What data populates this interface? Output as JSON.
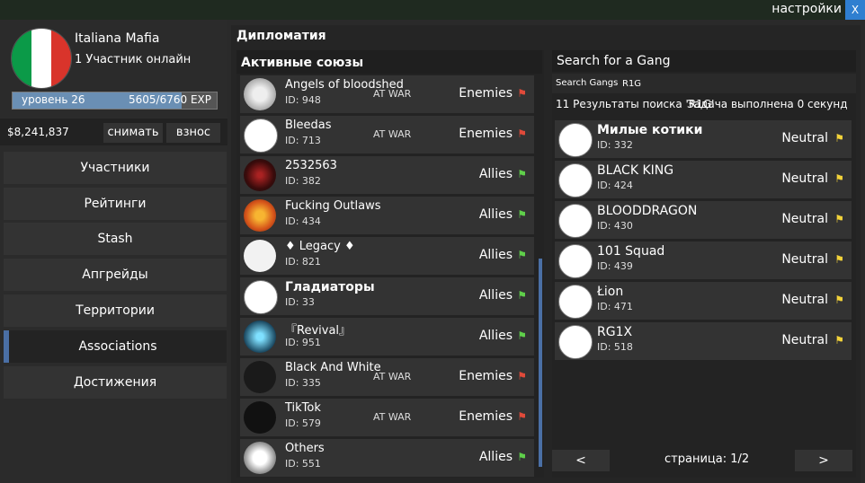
{
  "window": {
    "settings_label": "настройки",
    "close_label": "X"
  },
  "gang": {
    "name": "Italiana Mafia",
    "online": "1 Участник онлайн",
    "flag_colors": [
      "#0b9a48",
      "#ffffff",
      "#d9342b"
    ],
    "level": "уровень 26",
    "exp": "5605/6760 EXP",
    "exp_progress": 0.829,
    "money": "$8,241,837",
    "withdraw_label": "снимать",
    "deposit_label": "взнос"
  },
  "menu": [
    {
      "label": "Участники",
      "active": false
    },
    {
      "label": "Рейтинги",
      "active": false
    },
    {
      "label": "Stash",
      "active": false
    },
    {
      "label": "Апгрейды",
      "active": false
    },
    {
      "label": "Территории",
      "active": false
    },
    {
      "label": "Associations",
      "active": true
    },
    {
      "label": "Достижения",
      "active": false
    }
  ],
  "diplomacy": {
    "title": "Дипломатия",
    "alliances_title": "Активные союзы",
    "alliances": [
      {
        "name": "Angels of bloodshed",
        "id": "ID: 948",
        "war": "AT WAR",
        "relation": "Enemies",
        "avatar": "angels"
      },
      {
        "name": "Bleedas",
        "id": "ID: 713",
        "war": "AT WAR",
        "relation": "Enemies",
        "avatar": "blank"
      },
      {
        "name": "2532563",
        "id": "ID: 382",
        "war": "",
        "relation": "Allies",
        "avatar": "fire"
      },
      {
        "name": "Fucking Outlaws",
        "id": "ID: 434",
        "war": "",
        "relation": "Allies",
        "avatar": "skull"
      },
      {
        "name": "♦ Legacy ♦",
        "id": "ID: 821",
        "war": "",
        "relation": "Allies",
        "avatar": "legacy"
      },
      {
        "name": "Гладиаторы",
        "id": "ID: 33",
        "war": "",
        "relation": "Allies",
        "avatar": "blank",
        "bold": true
      },
      {
        "name": "『Revival』",
        "id": "ID: 951",
        "war": "",
        "relation": "Allies",
        "avatar": "revival"
      },
      {
        "name": "Black And White",
        "id": "ID: 335",
        "war": "AT WAR",
        "relation": "Enemies",
        "avatar": "dark"
      },
      {
        "name": "TikTok",
        "id": "ID: 579",
        "war": "AT WAR",
        "relation": "Enemies",
        "avatar": "tiktok"
      },
      {
        "name": "Others",
        "id": "ID: 551",
        "war": "",
        "relation": "Allies",
        "avatar": "wolf"
      }
    ]
  },
  "search": {
    "title": "Search for a Gang",
    "label": "Search Gangs",
    "query": "R1G",
    "results_info": "11 Результаты поиска 'R1G'",
    "task_info": "Задача выполнена 0 секунд",
    "results": [
      {
        "name": "Милые котики",
        "id": "ID: 332",
        "relation": "Neutral",
        "bold": true
      },
      {
        "name": "BLACK KING",
        "id": "ID: 424",
        "relation": "Neutral"
      },
      {
        "name": "BLOODDRAGON",
        "id": "ID: 430",
        "relation": "Neutral"
      },
      {
        "name": "101 Squad",
        "id": "ID: 439",
        "relation": "Neutral"
      },
      {
        "name": "Łion",
        "id": "ID: 471",
        "relation": "Neutral"
      },
      {
        "name": "RG1X",
        "id": "ID: 518",
        "relation": "Neutral"
      }
    ],
    "prev_label": "<",
    "next_label": ">",
    "page": "страница: 1/2"
  },
  "flag_colors": {
    "enemies": "#e04a3a",
    "allies": "#5fcf4a",
    "neutral": "#f2d23a"
  }
}
